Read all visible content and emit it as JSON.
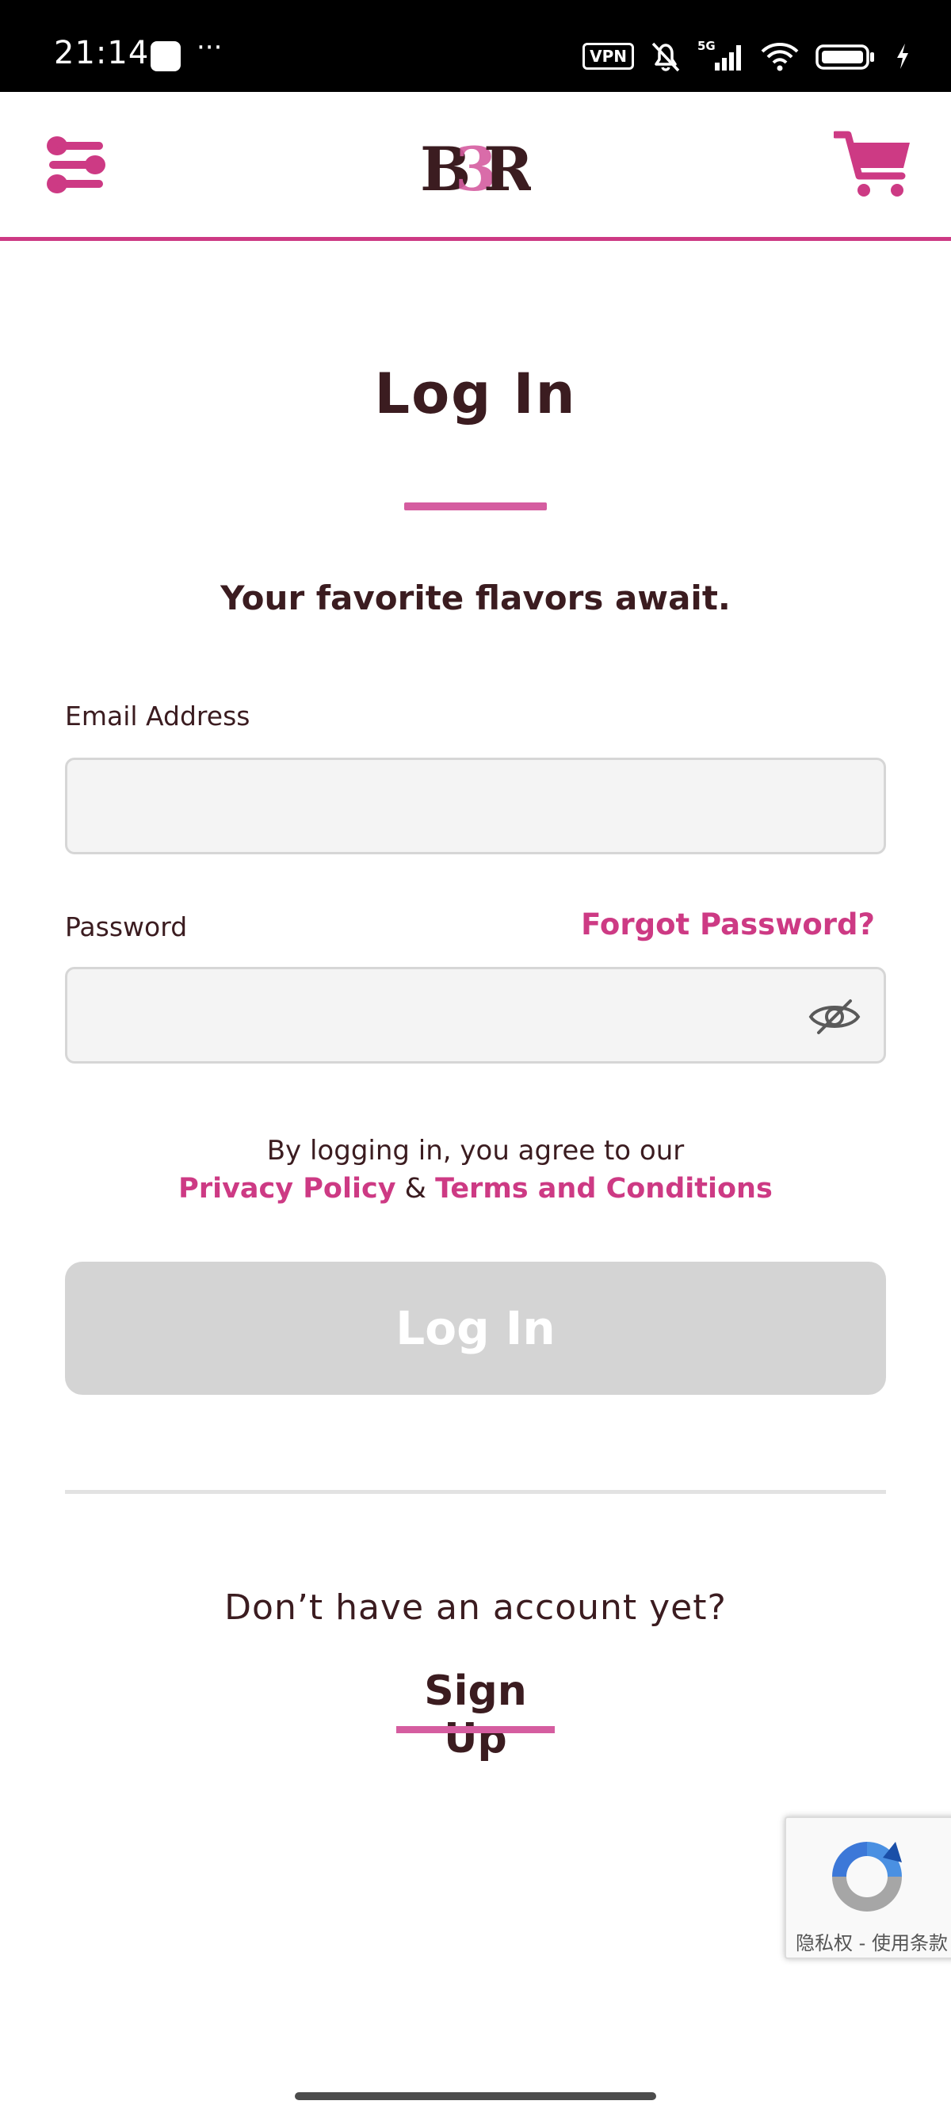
{
  "status_bar": {
    "time": "21:14",
    "dots": "···",
    "vpn": "VPN",
    "network": "5G"
  },
  "header": {
    "menu_icon": "spoons-menu-icon",
    "logo": "BR",
    "cart_icon": "cart-icon"
  },
  "login": {
    "title": "Log In",
    "subtitle": "Your favorite flavors await.",
    "email_label": "Email Address",
    "email_value": "",
    "email_placeholder": "",
    "password_label": "Password",
    "password_value": "",
    "password_placeholder": "",
    "forgot_label": "Forgot Password?",
    "agree_text": "By logging in, you agree to our",
    "privacy_label": "Privacy Policy",
    "ampersand": "&",
    "terms_label": "Terms and Conditions",
    "button_label": "Log In",
    "no_account_text": "Don’t have an account yet?",
    "signup_label": "Sign Up"
  },
  "recaptcha": {
    "text": "隐私权 - 使用条款"
  },
  "colors": {
    "brand_pink": "#cd3a84",
    "text_brown": "#3b1c20",
    "disabled_button": "#d4d4d4"
  }
}
